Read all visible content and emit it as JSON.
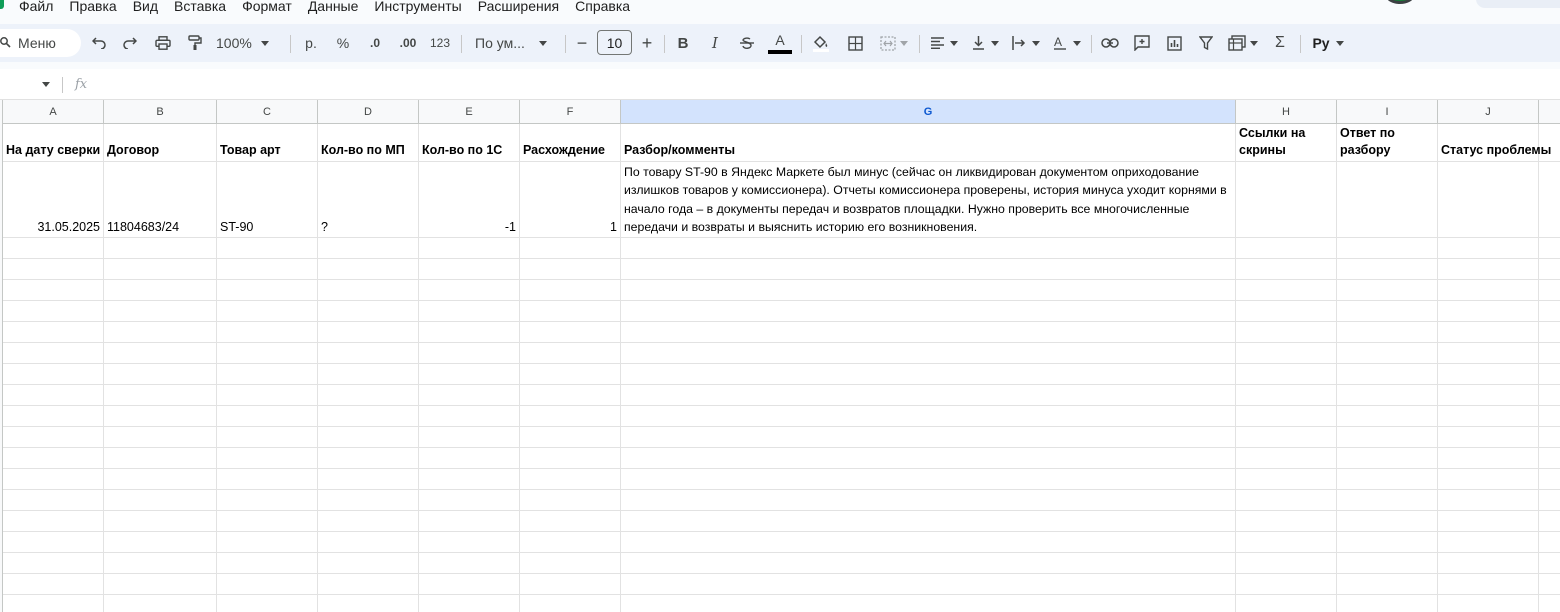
{
  "menu": [
    "Файл",
    "Правка",
    "Вид",
    "Вставка",
    "Формат",
    "Данные",
    "Инструменты",
    "Расширения",
    "Справка"
  ],
  "toolbar": {
    "search_label": "Меню",
    "zoom": "100%",
    "currency": "р.",
    "percent": "%",
    "decrease_decimals": ".0",
    "increase_decimals": ".00",
    "number_format": "123",
    "font_name": "По ум...",
    "font_size": "10",
    "bold": "B",
    "italic": "I",
    "text_color_letter": "A",
    "sum": "Σ",
    "input_tools": "Py"
  },
  "formula_bar": {
    "fx": "fx"
  },
  "columns": [
    "A",
    "B",
    "C",
    "D",
    "E",
    "F",
    "G",
    "H",
    "I",
    "J"
  ],
  "selected_column": "G",
  "header_row": {
    "a": "На дату сверки",
    "b": "Договор",
    "c": "Товар арт",
    "d": "Кол-во по МП",
    "e": "Кол-во по 1С",
    "f": "Расхождение",
    "g": "Разбор/комменты",
    "h": "Ссылки на скрины",
    "i": "Ответ по разбору",
    "j": "Статус проблемы"
  },
  "data_row": {
    "a": "31.05.2025",
    "b": "11804683/24",
    "c": "ST-90",
    "d": "?",
    "e": "-1",
    "f": "1",
    "g": "По товару ST-90 в Яндекс Маркете был минус (сейчас он ликвидирован документом оприходование излишков товаров у комиссионера). Отчеты комиссионера проверены, история минуса уходит корнями в начало года – в документы передач и возвратов площадки. Нужно проверить все многочисленные передачи и возвраты и выяснить историю его возникновения."
  }
}
